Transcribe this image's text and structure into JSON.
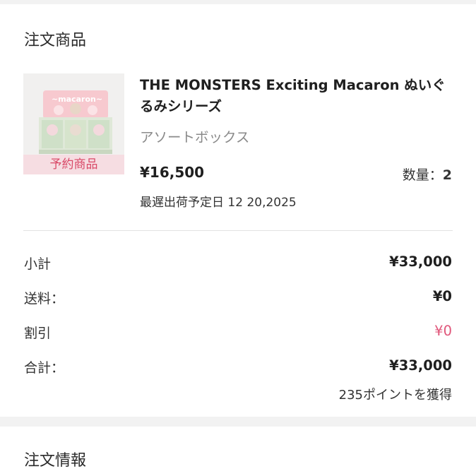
{
  "order_section": {
    "title": "注文商品",
    "product": {
      "name": "THE MONSTERS Exciting Macaron ぬいぐるみシリーズ",
      "variant": "アソートボックス",
      "badge": "予約商品",
      "price": "¥16,500",
      "quantity_label": "数量：",
      "quantity_value": "2",
      "ship_date": "最遅出荷予定日 12 20,2025",
      "image_icon": "product-box-image"
    },
    "summary": {
      "subtotal_label": "小計",
      "subtotal_value": "¥33,000",
      "shipping_label": "送料：",
      "shipping_value": "¥0",
      "discount_label": "割引",
      "discount_value": "¥0",
      "total_label": "合計：",
      "total_value": "¥33,000",
      "points_text": "235ポイントを獲得"
    }
  },
  "info_section": {
    "title": "注文情報"
  },
  "colors": {
    "badge_bg": "#f6dde2",
    "badge_text": "#d94a68",
    "discount_text": "#e0567a"
  }
}
